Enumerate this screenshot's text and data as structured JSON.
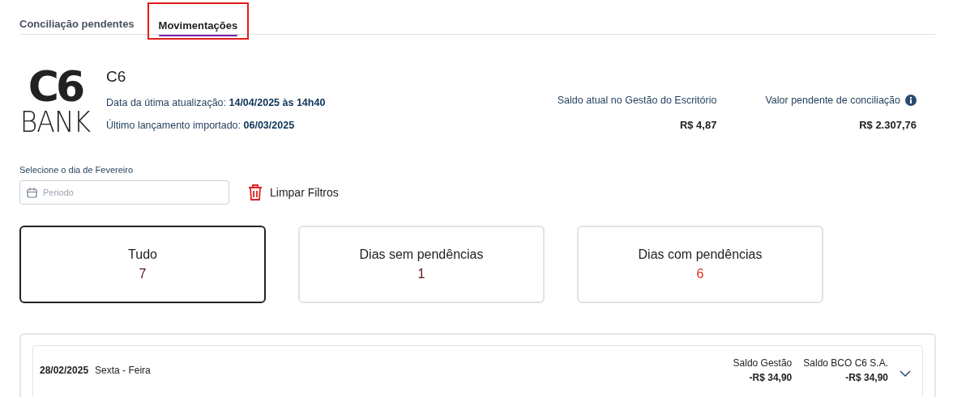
{
  "tabs": [
    {
      "label": "Conciliação pendentes",
      "selected": false,
      "highlighted": false
    },
    {
      "label": "Movimentações",
      "selected": true,
      "highlighted": true
    }
  ],
  "account": {
    "logo_top": "C6",
    "logo_bottom": "BANK",
    "name": "C6",
    "update_label": "Data da útima atualização:",
    "update_value": "14/04/2025 às 14h40",
    "import_label": "Último lançamento importado:",
    "import_value": "06/03/2025"
  },
  "balances": [
    {
      "label": "Saldo atual no Gestão do Escritório",
      "value": "R$ 4,87",
      "info": false
    },
    {
      "label": "Valor pendente de conciliação",
      "value": "R$ 2.307,76",
      "info": true
    }
  ],
  "filter": {
    "label": "Selecione o dia de Fevereiro",
    "placeholder": "Periodo",
    "clear": "Limpar Filtros"
  },
  "cards": [
    {
      "title": "Tudo",
      "count": "7",
      "selected": true,
      "alert": false
    },
    {
      "title": "Dias sem pendências",
      "count": "1",
      "selected": false,
      "alert": false
    },
    {
      "title": "Dias com pendências",
      "count": "6",
      "selected": false,
      "alert": true
    }
  ],
  "days": [
    {
      "date": "28/02/2025",
      "weekday": "Sexta - Feira",
      "expanded": false,
      "totals": [
        {
          "label": "Saldo Gestão",
          "value": "-R$ 34,90"
        },
        {
          "label": "Saldo BCO C6 S.A.",
          "value": "-R$ 34,90"
        }
      ]
    }
  ]
}
